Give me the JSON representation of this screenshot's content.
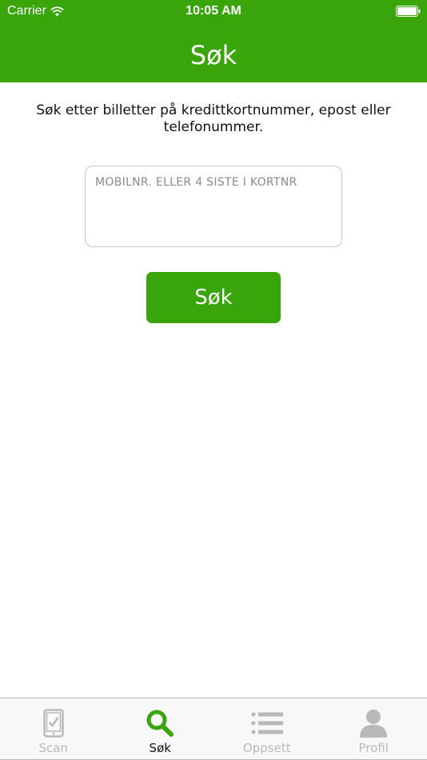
{
  "status_bar": {
    "carrier": "Carrier",
    "time": "10:05 AM"
  },
  "nav": {
    "title": "Søk"
  },
  "search": {
    "instructions": "Søk etter billetter på kredittkortnummer, epost eller telefonummer.",
    "placeholder": "MOBILNR. ELLER 4 SISTE I KORTNR",
    "value": "",
    "button_label": "Søk"
  },
  "tab_bar": {
    "active_tab": "Søk",
    "items": [
      {
        "label": "Scan",
        "icon": "phone-check-icon"
      },
      {
        "label": "Søk",
        "icon": "magnifier-icon"
      },
      {
        "label": "Oppsett",
        "icon": "list-icon"
      },
      {
        "label": "Profil",
        "icon": "person-icon"
      }
    ]
  },
  "colors": {
    "accent": "#3aa50a",
    "tab_inactive": "#b9b9b9",
    "tab_active_label": "#111111"
  }
}
